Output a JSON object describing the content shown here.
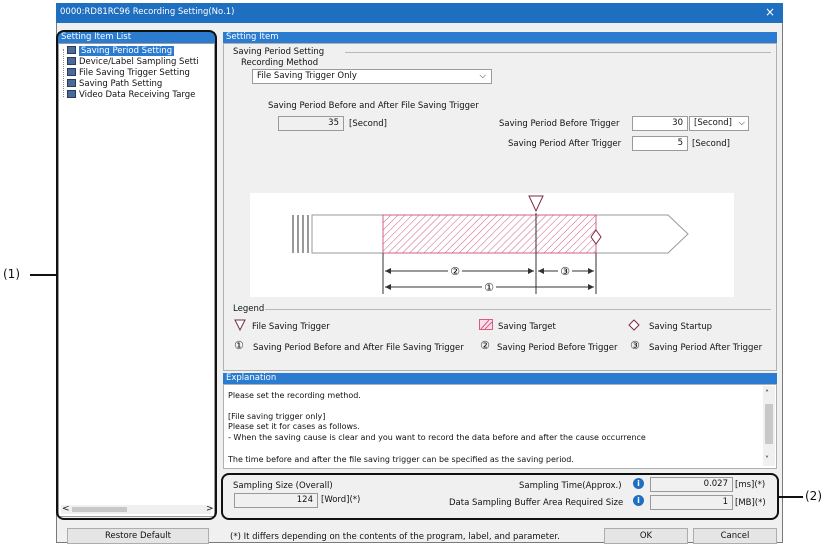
{
  "window": {
    "title": "0000:RD81RC96 Recording Setting(No.1)",
    "close_glyph": "×"
  },
  "left_panel": {
    "header": "Setting Item List",
    "items": [
      {
        "label": "Saving Period Setting",
        "icon": "setting-node-icon",
        "selected": true
      },
      {
        "label": "Device/Label Sampling Setti",
        "icon": "setting-node-icon"
      },
      {
        "label": "File Saving Trigger Setting",
        "icon": "setting-node-icon"
      },
      {
        "label": "Saving Path Setting",
        "icon": "setting-node-icon"
      },
      {
        "label": "Video Data Receiving Targe",
        "icon": "setting-node-icon"
      }
    ],
    "scroll_left": "<",
    "scroll_right": ">"
  },
  "setting_item": {
    "header": "Setting Item",
    "group_title": "Saving Period Setting",
    "recording_method_label": "Recording Method",
    "recording_method_value": "File Saving Trigger Only",
    "before_after_label": "Saving Period Before and After File Saving Trigger",
    "before_after_value": "35",
    "before_after_unit": "[Second]",
    "before_trigger_label": "Saving Period Before Trigger",
    "before_trigger_value": "30",
    "before_trigger_unit": "[Second]",
    "after_trigger_label": "Saving Period After Trigger",
    "after_trigger_value": "5",
    "after_trigger_unit": "[Second]"
  },
  "diagram": {
    "mark_1": "①",
    "mark_2": "②",
    "mark_3": "③"
  },
  "legend": {
    "title": "Legend",
    "file_saving_trigger": "File Saving Trigger",
    "saving_target": "Saving Target",
    "saving_startup": "Saving Startup",
    "item_1_mark": "①",
    "item_1": "Saving Period Before and After File Saving Trigger",
    "item_2_mark": "②",
    "item_2": "Saving Period Before Trigger",
    "item_3_mark": "③",
    "item_3": "Saving Period After Trigger"
  },
  "explanation": {
    "header": "Explanation",
    "lines": [
      "Please set the recording method.",
      "[File saving trigger only]",
      "Please set it for cases as follows.",
      "- When the saving cause is clear and you want to record the data before and after the cause occurrence",
      "The time before and after the file saving trigger can be specified as the saving period."
    ]
  },
  "sampling": {
    "size_label": "Sampling Size (Overall)",
    "size_value": "124",
    "size_unit": "[Word](*)",
    "time_label": "Sampling Time(Approx.)",
    "time_value": "0.027",
    "time_unit": "[ms](*)",
    "buffer_label": "Data Sampling Buffer Area Required Size",
    "buffer_value": "1",
    "buffer_unit": "[MB](*)"
  },
  "footer": {
    "restore_default": "Restore Default",
    "note": "(*) It differs depending on the contents of the program, label, and parameter.",
    "ok": "OK",
    "cancel": "Cancel"
  },
  "callouts": {
    "left": "(1)",
    "right": "(2)"
  },
  "colors": {
    "title_blue": "#1f6fc0",
    "header_blue": "#2b7bd1",
    "hatch": "#d06080"
  }
}
